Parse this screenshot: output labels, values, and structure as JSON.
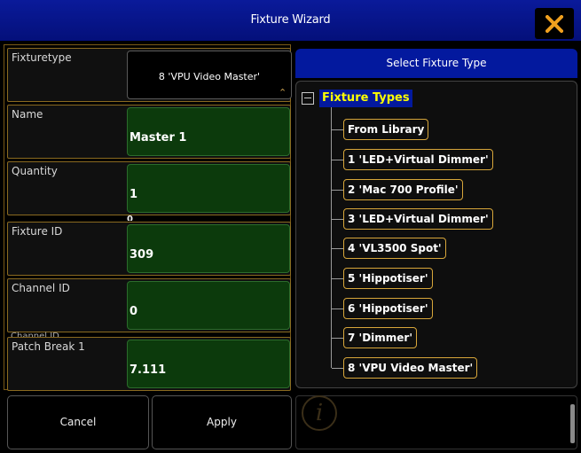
{
  "window": {
    "title": "Fixture Wizard",
    "close_icon": "close-x-icon",
    "accent_color": "#f0a01e"
  },
  "fields": {
    "fixturetype": {
      "label": "Fixturetype",
      "value": "8 'VPU Video Master'"
    },
    "name": {
      "label": "Name",
      "value": "Master 1"
    },
    "quantity": {
      "label": "Quantity",
      "value": "1"
    },
    "fixture_id": {
      "label": "Fixture ID",
      "value": "309"
    },
    "channel_id": {
      "label": "Channel ID",
      "value": "0"
    },
    "patch_break": {
      "label": "Patch Break 1",
      "value": "7.111"
    }
  },
  "ghost": {
    "quantity_overflow": "0",
    "channel_overflow": "Channel ID"
  },
  "buttons": {
    "cancel": "Cancel",
    "apply": "Apply"
  },
  "tree": {
    "header": "Select Fixture Type",
    "root": "Fixture Types",
    "items": [
      "From Library",
      "1 'LED+Virtual Dimmer'",
      "2 'Mac 700 Profile'",
      "3 'LED+Virtual Dimmer'",
      "4 'VL3500 Spot'",
      "5 'Hippotiser'",
      "6 'Hippotiser'",
      "7 'Dimmer'",
      "8 'VPU Video Master'"
    ]
  },
  "info": {
    "icon": "info-icon",
    "glyph": "i"
  }
}
